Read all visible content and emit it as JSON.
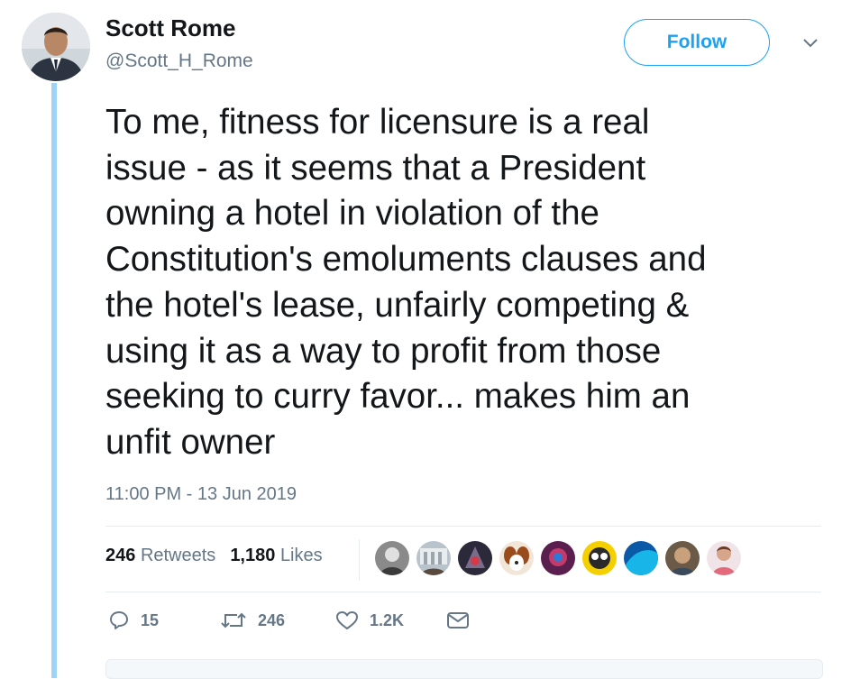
{
  "author": {
    "display_name": "Scott Rome",
    "handle": "@Scott_H_Rome",
    "avatar_icon": "profile-photo"
  },
  "follow_label": "Follow",
  "menu_icon": "chevron-down-icon",
  "tweet": {
    "text": "To me, fitness for licensure is a real\nissue - as it seems that a President\nowning a hotel in violation of the\nConstitution's emoluments clauses and\nthe hotel's lease, unfairly competing &\nusing it as a way to profit from those\nseeking to curry favor... makes him an\nunfit owner",
    "timestamp": "11:00 PM - 13 Jun 2019"
  },
  "stats": {
    "retweets": {
      "count": "246",
      "label": "Retweets"
    },
    "likes": {
      "count": "1,180",
      "label": "Likes"
    }
  },
  "actions": {
    "replies": "15",
    "retweets": "246",
    "likes": "1.2K"
  },
  "colors": {
    "accent": "#1da1f2",
    "thread_line": "#9fd3f5",
    "muted": "#657786",
    "text": "#14171a"
  }
}
